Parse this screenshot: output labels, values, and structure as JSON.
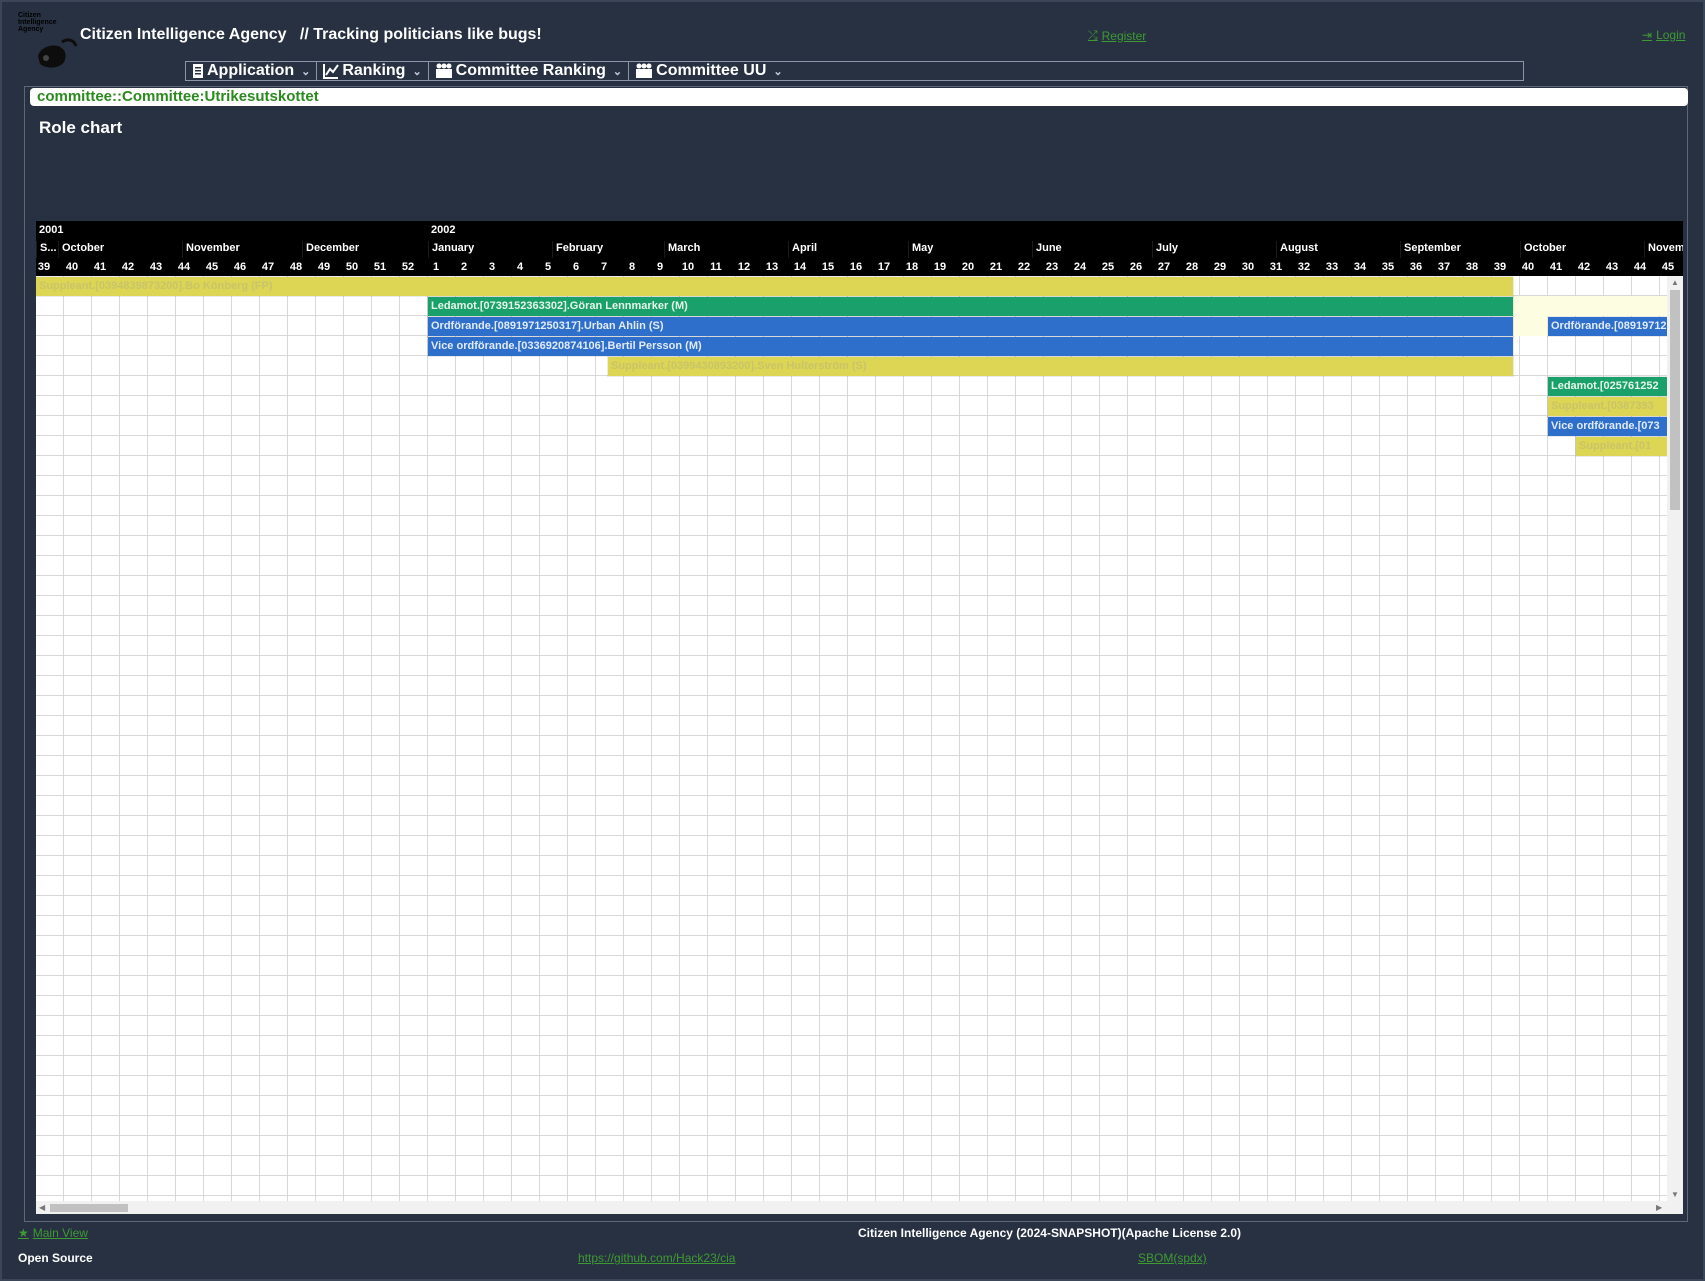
{
  "header": {
    "logo_text": "Citizen Intelligence Agency",
    "brand": "Citizen Intelligence Agency",
    "tagline": "// Tracking politicians like bugs!",
    "register_label": "Register",
    "login_label": "Login"
  },
  "menubar": [
    {
      "label": "Application",
      "icon": "document-icon"
    },
    {
      "label": "Ranking",
      "icon": "line-chart-icon"
    },
    {
      "label": "Committee Ranking",
      "icon": "group-icon"
    },
    {
      "label": "Committee UU",
      "icon": "group-icon"
    }
  ],
  "breadcrumb": "committee::Committee:Utrikesutskottet",
  "page": {
    "title": "Role chart"
  },
  "timeline": {
    "years": [
      "2001",
      "2002"
    ],
    "months": [
      "S...",
      "October",
      "November",
      "December",
      "January",
      "February",
      "March",
      "April",
      "May",
      "June",
      "July",
      "August",
      "September",
      "October",
      "Novem"
    ],
    "weeks": [
      "39",
      "40",
      "41",
      "42",
      "43",
      "44",
      "45",
      "46",
      "47",
      "48",
      "49",
      "50",
      "51",
      "52",
      "1",
      "2",
      "3",
      "4",
      "5",
      "6",
      "7",
      "8",
      "9",
      "10",
      "11",
      "12",
      "13",
      "14",
      "15",
      "16",
      "17",
      "18",
      "19",
      "20",
      "21",
      "22",
      "23",
      "24",
      "25",
      "26",
      "27",
      "28",
      "29",
      "30",
      "31",
      "32",
      "33",
      "34",
      "35",
      "36",
      "37",
      "38",
      "39",
      "40",
      "41",
      "42",
      "43",
      "44",
      "45"
    ]
  },
  "roles": [
    {
      "label": "Suppleant.[0394839873200].Bo Könberg (FP)",
      "type": "suppleant",
      "color": "#dcd654"
    },
    {
      "label": "Ledamot.[0739152363302].Göran Lennmarker (M)",
      "type": "ledamot",
      "color": "#1aa06a"
    },
    {
      "label": "Ordförande.[0891971250317].Urban Ahlin (S)",
      "type": "ordforande",
      "color": "#2f6fcc"
    },
    {
      "label": "Vice ordförande.[0336920874106].Bertil Persson (M)",
      "type": "vice",
      "color": "#2f6fcc"
    },
    {
      "label": "Suppleant.[0399430893200].Sven Hulterström (S)",
      "type": "suppleant",
      "color": "#dcd654"
    },
    {
      "label": "Ordförande.[08919712",
      "type": "ordforande",
      "color": "#2f6fcc"
    },
    {
      "label": "Ledamot.[025761252",
      "type": "ledamot",
      "color": "#1aa06a"
    },
    {
      "label": "Suppleant.[0387393",
      "type": "suppleant",
      "color": "#dcd654"
    },
    {
      "label": "Vice ordförande.[073",
      "type": "vice",
      "color": "#2f6fcc"
    },
    {
      "label": "Suppleant.[01",
      "type": "suppleant",
      "color": "#dcd654"
    }
  ],
  "footer": {
    "main_view": "Main View",
    "copyright": "Citizen Intelligence Agency (2024-SNAPSHOT)(Apache License 2.0)",
    "open_source": "Open Source",
    "github": "https://github.com/Hack23/cia",
    "sbom": "SBOM(spdx)"
  }
}
